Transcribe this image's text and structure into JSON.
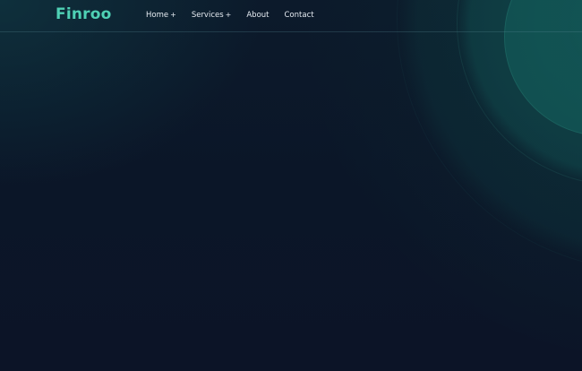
{
  "brand": {
    "logo_text": "Finroo",
    "accent_color": "#4fd1b5"
  },
  "nav": {
    "items": [
      {
        "label": "Home",
        "suffix": "+"
      },
      {
        "label": "Services",
        "suffix": "+"
      },
      {
        "label": "About",
        "suffix": ""
      },
      {
        "label": "Contact",
        "suffix": ""
      }
    ]
  },
  "colors": {
    "background": "#0c1628",
    "nav_text": "#e6ecf2"
  }
}
